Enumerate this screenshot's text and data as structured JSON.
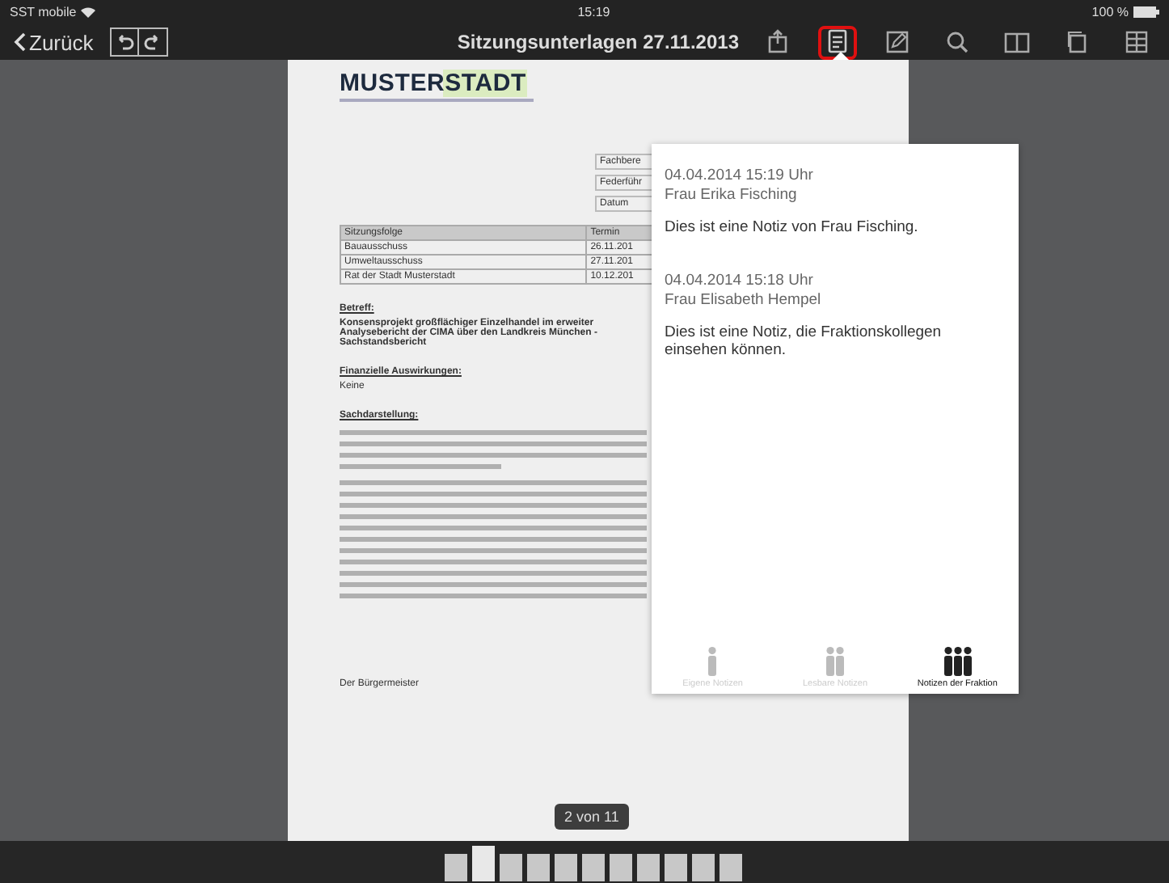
{
  "status_bar": {
    "carrier": "SST mobile",
    "time": "15:19",
    "battery": "100 %"
  },
  "toolbar": {
    "back": "Zurück",
    "title": "Sitzungsunterlagen 27.11.2013",
    "icons": [
      {
        "kind": "share",
        "selected": false
      },
      {
        "kind": "notes",
        "selected": true
      },
      {
        "kind": "edit",
        "selected": false
      },
      {
        "kind": "search",
        "selected": false
      },
      {
        "kind": "book",
        "selected": false
      },
      {
        "kind": "copy",
        "selected": false
      },
      {
        "kind": "grid",
        "selected": false
      }
    ]
  },
  "document": {
    "logo": "MUSTERSTADT",
    "info_labels": [
      "Fachbere",
      "Federführ",
      "Datum"
    ],
    "table": {
      "columns": [
        "Sitzungsfolge",
        "Termin"
      ],
      "rows": [
        [
          "Bauausschuss",
          "26.11.201"
        ],
        [
          "Umweltausschuss",
          "27.11.201"
        ],
        [
          "Rat der Stadt Musterstadt",
          "10.12.201"
        ]
      ]
    },
    "subject_heading": "Betreff:",
    "subject": "Konsensprojekt großflächiger Einzelhandel im erweiter Analysebericht der CIMA über den Landkreis München - Sachstandsbericht",
    "finance_heading": "Finanzielle Auswirkungen:",
    "finance": "Keine",
    "facts_heading": "Sachdarstellung:",
    "signature": "Der Bürgermeister"
  },
  "page_indicator": "2 von 11",
  "notes": {
    "entries": [
      {
        "timestamp": "04.04.2014 15:19 Uhr",
        "author": "Frau Erika Fisching",
        "text": "Dies ist eine Notiz von Frau Fisching."
      },
      {
        "timestamp": "04.04.2014 15:18 Uhr",
        "author": "Frau Elisabeth Hempel",
        "text": "Dies ist eine Notiz, die Fraktionskollegen einsehen können."
      }
    ],
    "tabs": [
      {
        "label": "Eigene Notizen",
        "selected": false
      },
      {
        "label": "Lesbare Notizen",
        "selected": false
      },
      {
        "label": "Notizen der Fraktion",
        "selected": true
      }
    ]
  },
  "thumbnails": [
    {
      "selected": false
    },
    {
      "selected": true
    },
    {
      "selected": false
    },
    {
      "selected": false
    },
    {
      "selected": false
    },
    {
      "selected": false
    },
    {
      "selected": false
    },
    {
      "selected": false
    },
    {
      "selected": false
    },
    {
      "selected": false
    },
    {
      "selected": false
    }
  ]
}
